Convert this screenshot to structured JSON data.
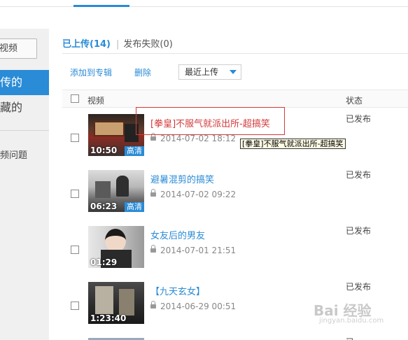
{
  "sidebar": {
    "button_label": "视频",
    "items": [
      {
        "label": "传的",
        "active": true
      },
      {
        "label": "藏的",
        "active": false
      }
    ],
    "faq_label": "频问题"
  },
  "tabs": {
    "uploaded": "已上传(14)",
    "separator": "|",
    "failed": "发布失败(0)"
  },
  "toolbar": {
    "add_to_album": "添加到专辑",
    "delete": "删除",
    "sort_selected": "最近上传"
  },
  "table": {
    "col_video": "视频",
    "col_status": "状态"
  },
  "videos": [
    {
      "title": "[拳皇]不服气就派出所-超搞笑",
      "date": "2014-07-02 18:12",
      "duration": "10:50",
      "hd": "高清",
      "status": "已发布"
    },
    {
      "title": "避暑混剪的搞笑",
      "date": "2014-07-02 09:22",
      "duration": "06:23",
      "hd": "高清",
      "status": "已发布"
    },
    {
      "title": "女友后的男友",
      "date": "2014-07-01 21:51",
      "duration": "01:29",
      "hd": "",
      "status": "已发布"
    },
    {
      "title": "【九天玄女】",
      "date": "2014-06-29 00:51",
      "duration": "1:23:40",
      "hd": "",
      "status": "已发布"
    }
  ],
  "tooltip": "[拳皇]不服气就派出所-超搞笑",
  "watermark": {
    "main": "Bai 经验",
    "sub": "jingyan.baidu.com"
  },
  "colors": {
    "accent": "#2a8bd6",
    "highlight": "#d23a3a"
  }
}
